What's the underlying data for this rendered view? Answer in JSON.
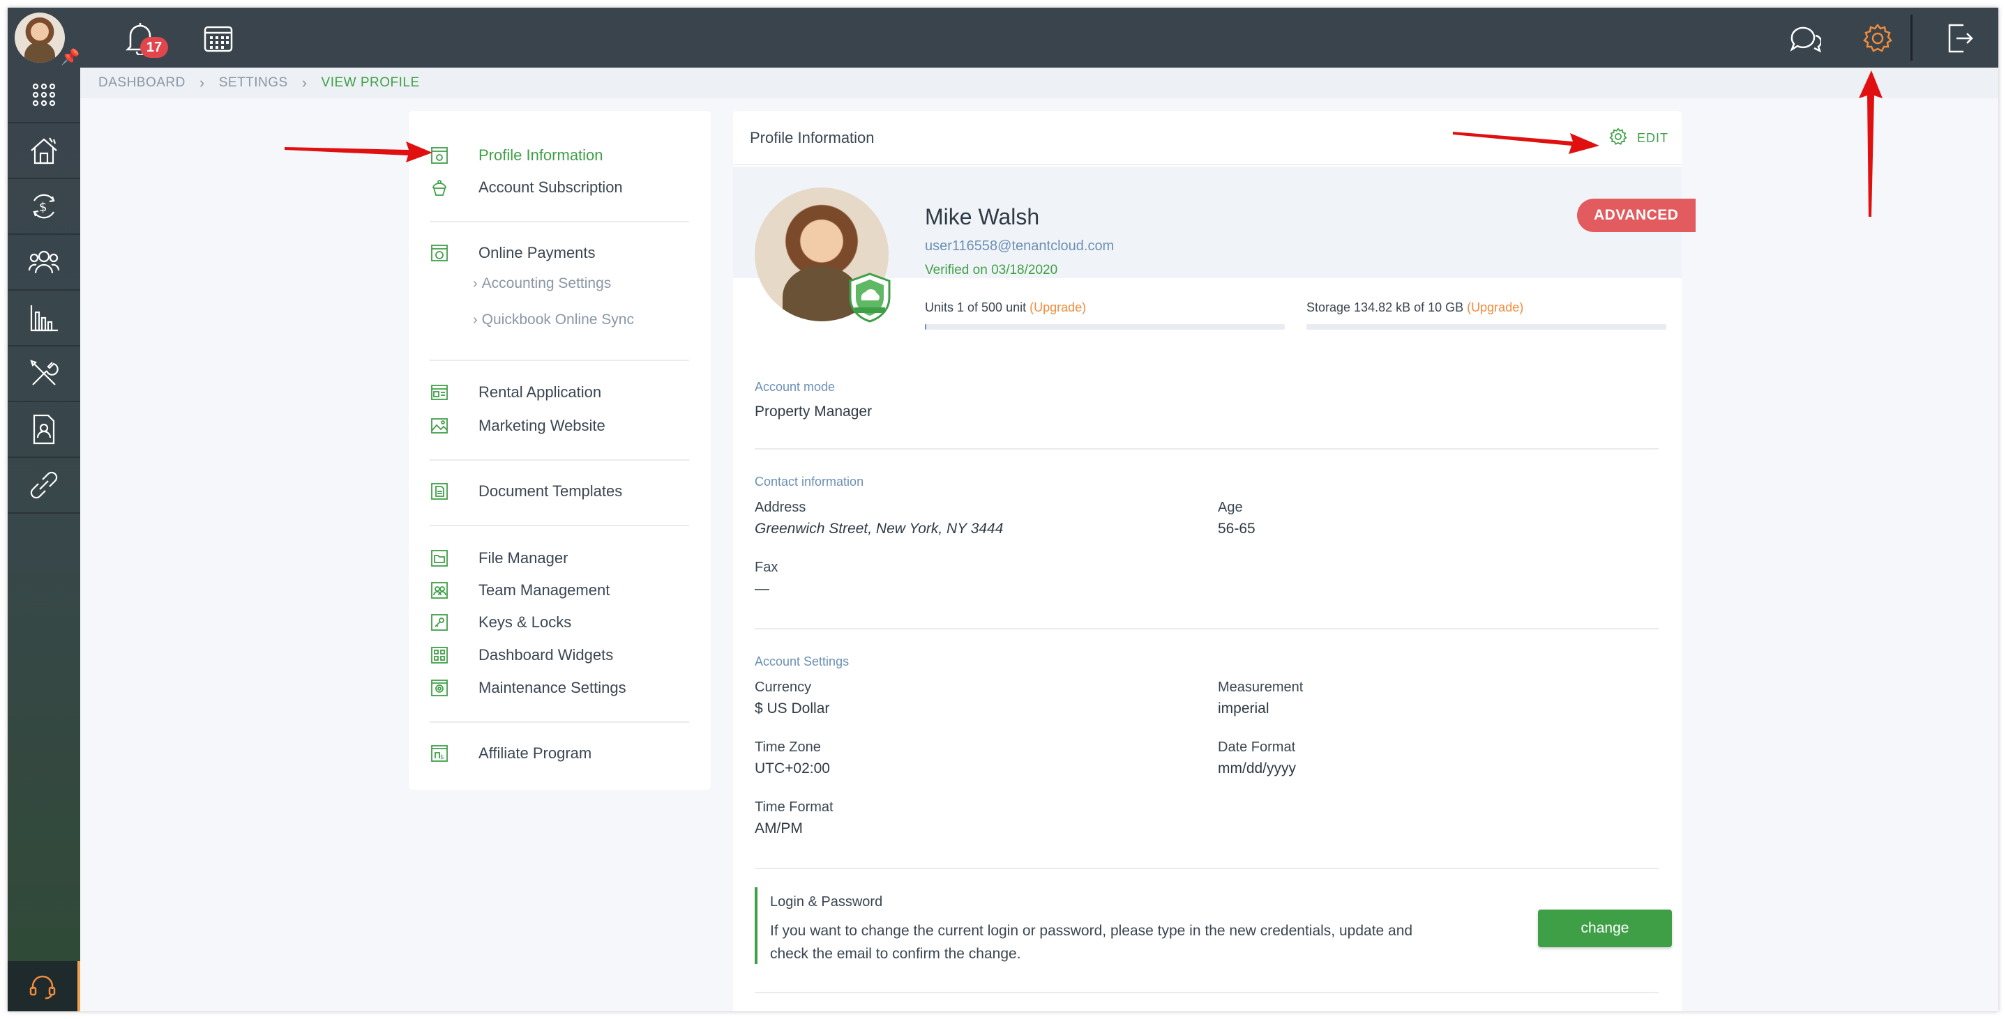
{
  "topbar": {
    "notification_count": "17"
  },
  "breadcrumb": {
    "items": [
      "DASHBOARD",
      "SETTINGS",
      "VIEW PROFILE"
    ]
  },
  "menu": {
    "profile_information": "Profile Information",
    "account_subscription": "Account Subscription",
    "online_payments": "Online Payments",
    "accounting_settings": "Accounting Settings",
    "quickbook_online_sync": "Quickbook Online Sync",
    "rental_application": "Rental Application",
    "marketing_website": "Marketing Website",
    "document_templates": "Document Templates",
    "file_manager": "File Manager",
    "team_management": "Team Management",
    "keys_locks": "Keys & Locks",
    "dashboard_widgets": "Dashboard Widgets",
    "maintenance_settings": "Maintenance Settings",
    "affiliate_program": "Affiliate Program"
  },
  "profile": {
    "card_title": "Profile Information",
    "edit_label": "EDIT",
    "name": "Mike Walsh",
    "email": "user116558@tenantcloud.com",
    "verified": "Verified on 03/18/2020",
    "plan_badge": "ADVANCED",
    "units_label": "Units 1 of 500 unit",
    "storage_label": "Storage 134.82 kB of 10 GB",
    "upgrade_label": "(Upgrade)",
    "units_fraction": 0.002,
    "storage_fraction": 0.0
  },
  "account_mode": {
    "title": "Account mode",
    "value": "Property Manager"
  },
  "contact": {
    "title": "Contact information",
    "address_label": "Address",
    "address_value": "Greenwich Street, New York, NY 3444",
    "age_label": "Age",
    "age_value": "56-65",
    "fax_label": "Fax",
    "fax_value": "—"
  },
  "account_settings": {
    "title": "Account Settings",
    "currency_label": "Currency",
    "currency_value": "$ US Dollar",
    "measurement_label": "Measurement",
    "measurement_value": "imperial",
    "timezone_label": "Time Zone",
    "timezone_value": "UTC+02:00",
    "date_format_label": "Date Format",
    "date_format_value": "mm/dd/yyyy",
    "time_format_label": "Time Format",
    "time_format_value": "AM/PM"
  },
  "login": {
    "title": "Login & Password",
    "description": "If you want to change the current login or password, please type in the new credentials, update and check the email to confirm the change.",
    "button": "change"
  },
  "colors": {
    "accent_green": "#3f9f47",
    "topbar": "#3a444d",
    "badge_red": "#e25b5e",
    "upgrade_orange": "#f08c3c",
    "link_blue": "#6c8fb5",
    "annotation_red": "#e01010"
  }
}
